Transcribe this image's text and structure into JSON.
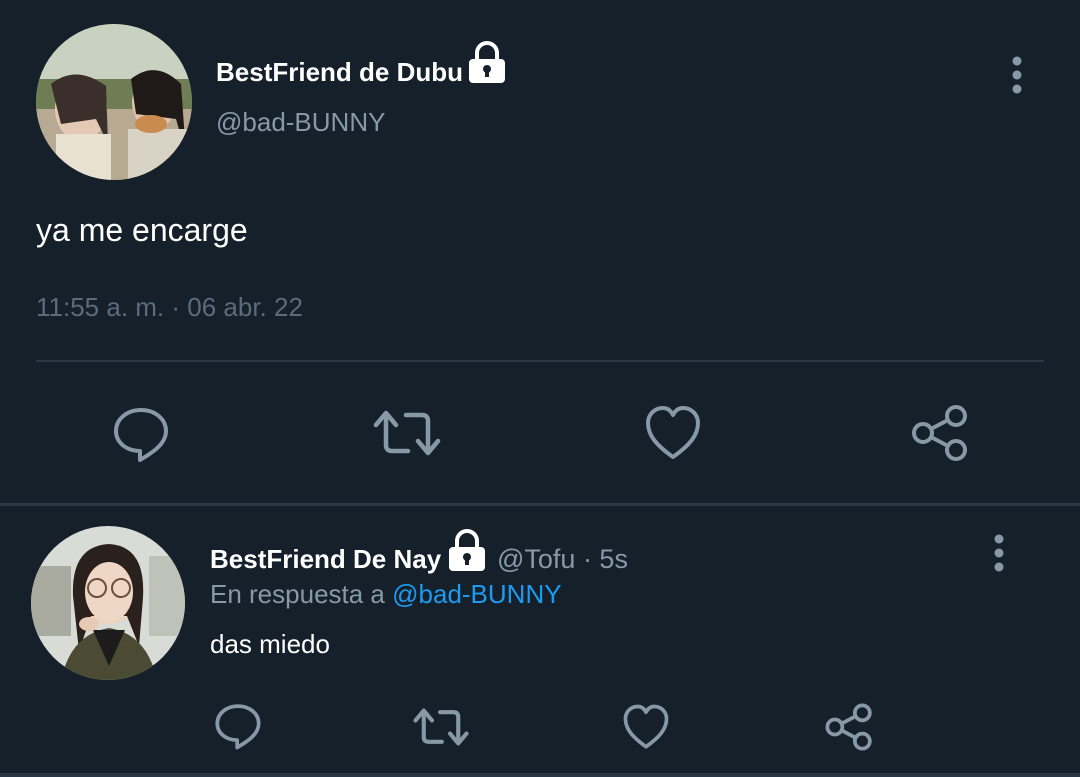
{
  "main_tweet": {
    "author_name": "BestFriend de Dubu",
    "handle": "@bad-BUNNY",
    "text": "ya me encarge",
    "timestamp": "11:55 a. m. · 06 abr. 22",
    "avatar": "avatar-photo-two-girls",
    "lock_icon": "lock-icon",
    "actions": [
      "reply-icon",
      "retweet-icon",
      "like-icon",
      "share-icon"
    ]
  },
  "reply_tweet": {
    "author_name": "BestFriend De Nay",
    "handle_time": "@Tofu · 5s",
    "replying_prefix": "En respuesta a ",
    "replying_to": "@bad-BUNNY",
    "text": "das miedo",
    "avatar": "avatar-photo-girl-glasses",
    "lock_icon": "lock-icon",
    "actions": [
      "reply-icon",
      "retweet-icon",
      "like-icon",
      "share-icon"
    ]
  },
  "colors": {
    "background": "#15202b",
    "secondary_text": "#8899a6",
    "link": "#1d9bf0",
    "icon": "#8899a6"
  }
}
